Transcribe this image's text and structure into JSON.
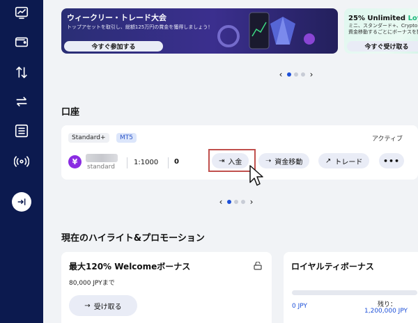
{
  "sidebar": {
    "icons": [
      "chart-icon",
      "wallet-icon",
      "transfer-vertical-icon",
      "swap-horizontal-icon",
      "list-icon",
      "signal-icon",
      "exit-icon"
    ]
  },
  "banners": [
    {
      "title": "ウィークリー・トレード大会",
      "subtitle": "トップアセットを取引し、総額125万円の賞金を獲得しましょう！",
      "button": "今すぐ参加する"
    },
    {
      "title_prefix": "25% Unlimited ",
      "title_highlight": "Loyaltyボーナス",
      "subtitle": "ミニ、スタンダード+、Crypto Max口座に資金移動するごとにボーナスを獲得！",
      "button": "今すぐ受け取る"
    }
  ],
  "banner_pager": {
    "prev": "‹",
    "next": "›",
    "active_index": 0,
    "count": 3
  },
  "accounts": {
    "section_title": "口座",
    "card": {
      "tag_type": "Standard+",
      "tag_platform": "MT5",
      "status": "アクティブ",
      "currency_symbol": "¥",
      "account_type": "standard",
      "leverage": "1:1000",
      "balance": "0",
      "actions": {
        "deposit": "入金",
        "transfer": "資金移動",
        "trade": "トレード",
        "more": "•••"
      }
    },
    "pager": {
      "prev": "‹",
      "next": "›",
      "active_index": 0,
      "count": 3
    }
  },
  "promotions": {
    "section_title": "現在のハイライト&プロモーション",
    "cards": [
      {
        "title": "最大120% Welcomeボーナス",
        "subtitle": "80,000 JPYまで",
        "button": "受け取る"
      },
      {
        "title": "ロイヤルティボーナス",
        "progress_value": "0 JPY",
        "remaining_label": "残り：",
        "remaining_value": "1,200,000 JPY",
        "progress_fraction": 0
      }
    ]
  },
  "colors": {
    "sidebar_bg": "#0c1a4f",
    "accent_blue": "#1c4fd8",
    "highlight_box": "#c0504d",
    "loyalty_green": "#1bb87a"
  }
}
